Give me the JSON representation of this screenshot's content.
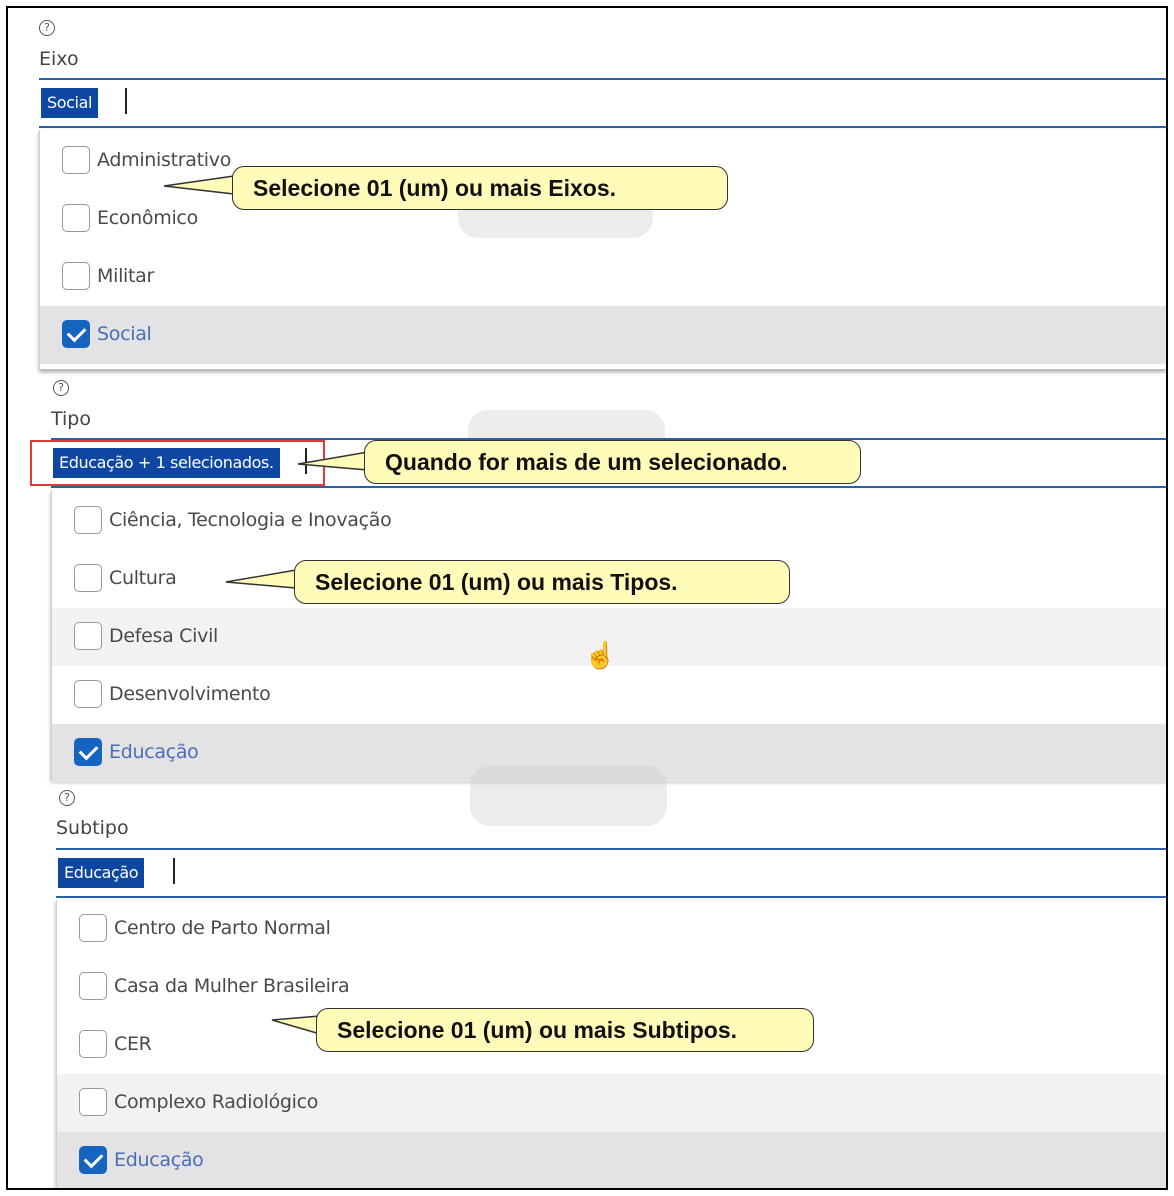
{
  "eixo": {
    "label": "Eixo",
    "chip": "Social",
    "options": [
      {
        "label": "Administrativo",
        "checked": false
      },
      {
        "label": "Econômico",
        "checked": false
      },
      {
        "label": "Militar",
        "checked": false
      },
      {
        "label": "Social",
        "checked": true
      }
    ],
    "callout": "Selecione 01 (um) ou mais Eixos."
  },
  "tipo": {
    "label": "Tipo",
    "chip": "Educação + 1 selecionados.",
    "options": [
      {
        "label": "Ciência, Tecnologia e Inovação",
        "checked": false
      },
      {
        "label": "Cultura",
        "checked": false
      },
      {
        "label": "Defesa Civil",
        "checked": false
      },
      {
        "label": "Desenvolvimento",
        "checked": false
      },
      {
        "label": "Educação",
        "checked": true
      }
    ],
    "callout_multi": "Quando for mais de um selecionado.",
    "callout": "Selecione 01 (um) ou mais Tipos."
  },
  "subtipo": {
    "label": "Subtipo",
    "chip": "Educação",
    "options": [
      {
        "label": "Centro de Parto Normal",
        "checked": false
      },
      {
        "label": "Casa da Mulher Brasileira",
        "checked": false
      },
      {
        "label": "CER",
        "checked": false
      },
      {
        "label": "Complexo Radiológico",
        "checked": false
      },
      {
        "label": "Educação",
        "checked": true
      }
    ],
    "callout": "Selecione 01 (um) ou mais Subtipos."
  },
  "icons": {
    "help": "question-circle-icon",
    "pointer": "hand-pointer-icon"
  },
  "colors": {
    "accent": "#0d47a1",
    "checkbox_checked": "#1565c0",
    "callout_bg": "#fffbb8",
    "highlight_box": "#e53935"
  }
}
